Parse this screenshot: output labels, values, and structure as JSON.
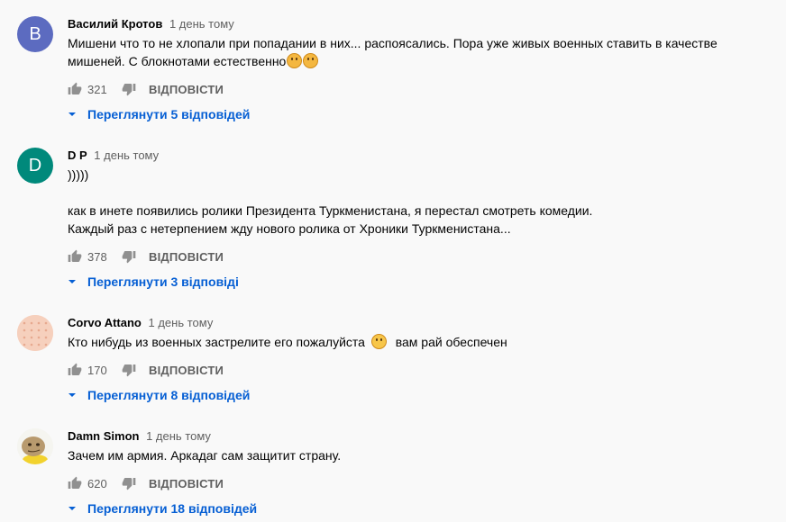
{
  "comments": [
    {
      "author": "Василий Кротов",
      "time": "1 день тому",
      "avatar_letter": "B",
      "avatar_color": "#5c6bc0",
      "lines": [
        "Мишени что то не хлопали при попадании в них... распоясались. Пора уже живых военных ставить в качестве",
        "мишеней. С блокнотами естественно"
      ],
      "likes": "321",
      "reply_label": "ВІДПОВІСТИ",
      "view_replies": "Переглянути 5 відповідей"
    },
    {
      "author": "D P",
      "time": "1 день тому",
      "avatar_letter": "D",
      "avatar_color": "#00897b",
      "lines": [
        ")))))",
        "",
        "как в инете появились ролики Президента Туркменистана, я перестал смотреть комедии.",
        "Каждый раз с нетерпением жду нового ролика от Хроники Туркменистана..."
      ],
      "likes": "378",
      "reply_label": "ВІДПОВІСТИ",
      "view_replies": "Переглянути 3 відповіді"
    },
    {
      "author": "Corvo Attano",
      "time": "1 день тому",
      "avatar_letter": "",
      "avatar_color": "#f3c9b5",
      "lines": [
        "Кто нибудь из военных застрелите его пожалуйста",
        "вам рай обеспечен"
      ],
      "likes": "170",
      "reply_label": "ВІДПОВІСТИ",
      "view_replies": "Переглянути 8 відповідей"
    },
    {
      "author": "Damn Simon",
      "time": "1 день тому",
      "avatar_letter": "",
      "avatar_color": "#f2f2f2",
      "lines": [
        "Зачем им армия. Аркадаг сам защитит страну."
      ],
      "likes": "620",
      "reply_label": "ВІДПОВІСТИ",
      "view_replies": "Переглянути 18 відповідей"
    }
  ],
  "icons": {
    "like": "thumb-up-icon",
    "dislike": "thumb-down-icon",
    "expand": "chevron-down-icon"
  }
}
